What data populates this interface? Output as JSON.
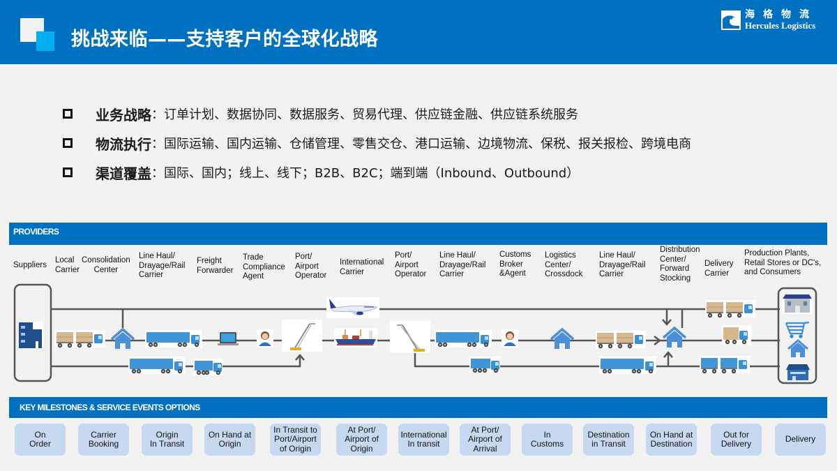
{
  "header": {
    "title": "挑战来临——支持客户的全球化战略",
    "brand_cn": "海格物流",
    "brand_en": "Hercules Logistics"
  },
  "bullets": [
    {
      "key": "业务战略",
      "text": "：订单计划、数据协同、数据服务、贸易代理、供应链金融、供应链系统服务"
    },
    {
      "key": "物流执行",
      "text": "：国际运输、国内运输、仓储管理、零售交仓、港口运输、边境物流、保税、报关报检、跨境电商"
    },
    {
      "key": "渠道覆盖",
      "text": "：国际、国内；线上、线下；B2B、B2C；端到端（Inbound、Outbound）"
    }
  ],
  "providers": {
    "band_label": "PROVIDERS",
    "items": [
      "Suppliers",
      "Local\nCarrier",
      "Consolidation\nCenter",
      "Line Haul/\nDrayage/Rail\nCarrier",
      "Freight\nForwarder",
      "Trade\nCompliance\nAgent",
      "Port/\nAirport\nOperator",
      "International\nCarrier",
      "Port/\nAirport\nOperator",
      "Line Haul/\nDrayage/Rail\nCarrier",
      "Customs\nBroker\n&Agent",
      "Logistics\nCenter/\nCrossdock",
      "Line Haul/\nDrayage/Rail\nCarrier",
      "Distribution\nCenter/\nForward\nStocking",
      "Delivery\nCarrier",
      "Production Plants,\nRetail Stores or DC's,\nand Consumers"
    ]
  },
  "flow_icons": {
    "supplier": "office-building-icon",
    "trucks": "truck-icon",
    "warehouse": "house-icon",
    "laptop": "laptop-icon",
    "agent": "person-icon",
    "crane": "crane-icon",
    "ship": "cargo-ship-icon",
    "plane": "airplane-icon",
    "store": "store-icon",
    "cart": "shopping-cart-icon"
  },
  "milestones": {
    "band_label": "KEY  MILESTONES & SERVICE EVENTS  OPTIONS",
    "items": [
      "On\nOrder",
      "Carrier\nBooking",
      "Origin\nIn Transit",
      "On Hand at\nOrigin",
      "In Transit to\nPort/Airport\nof Origin",
      "At Port/\nAirport of\nOrigin",
      "International\nIn transit",
      "At Port/\nAirport of\nArrival",
      "In\nCustoms",
      "Destination\nin Transit",
      "On Hand at\nDestination",
      "Out  for\nDelivery",
      "Delivery"
    ]
  },
  "colors": {
    "brand_blue": "#0070c0",
    "accent_cyan": "#00b0f0",
    "milestone_fill": "#c6d9f1",
    "background": "#f2f2f2"
  }
}
